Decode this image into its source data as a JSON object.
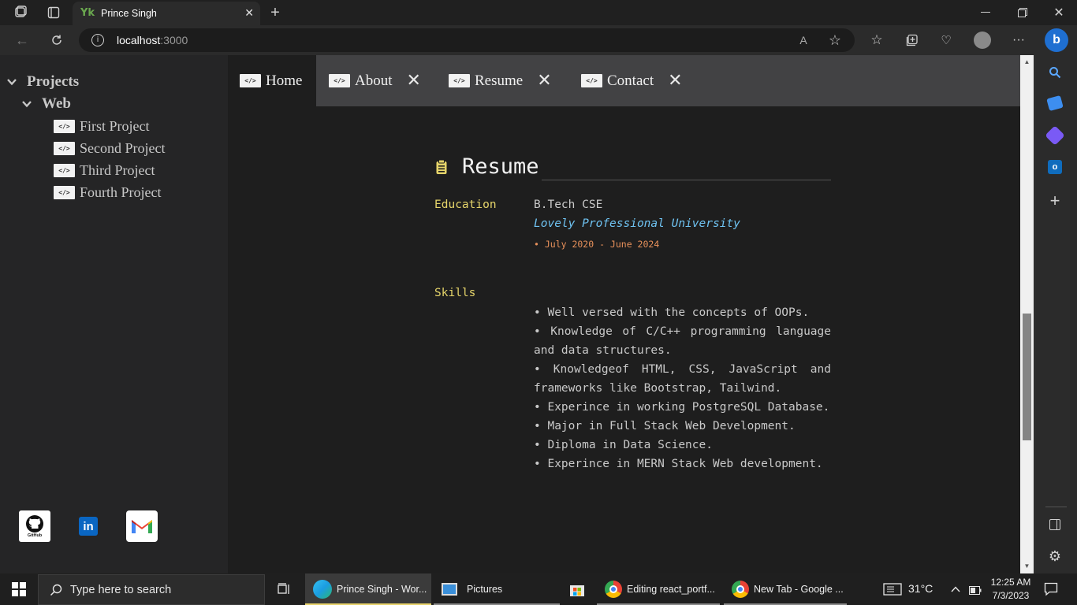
{
  "browser": {
    "tab_title": "Prince Singh",
    "url_host": "localhost",
    "url_port": ":3000"
  },
  "explorer": {
    "root_label": "Projects",
    "folder_label": "Web",
    "code_badge": "</>",
    "projects": [
      "First Project",
      "Second Project",
      "Third Project",
      "Fourth Project"
    ]
  },
  "social": {
    "github_caption": "GitHub",
    "linkedin_text": "in"
  },
  "editor_tabs": {
    "home": "Home",
    "about": "About",
    "resume": "Resume",
    "contact": "Contact"
  },
  "resume": {
    "heading": "Resume",
    "education_label": "Education",
    "degree": "B.Tech CSE",
    "school": "Lovely Professional University",
    "dates": "• July 2020 - June 2024",
    "skills_label": "Skills",
    "skills": [
      "• Well versed with the concepts of OOPs.",
      "• Knowledge of C/C++ programming language and data structures.",
      "• Knowledgeof HTML, CSS, JavaScript and frameworks like Bootstrap, Tailwind.",
      "• Experince in working PostgreSQL Database.",
      "• Major in Full Stack Web Development.",
      "• Diploma in Data Science.",
      "• Experince in MERN Stack Web development."
    ]
  },
  "taskbar": {
    "search_placeholder": "Type here to search",
    "apps": [
      "Prince Singh - Wor...",
      "Pictures",
      "Editing react_portf...",
      "New Tab - Google ..."
    ],
    "weather": "31°C",
    "time": "12:25 AM",
    "date": "7/3/2023"
  },
  "colors": {
    "section_label": "#e5d46a",
    "school": "#6fc3f2",
    "dates": "#e8915b",
    "tabstrip": "#424244",
    "explorer_bg": "#252526",
    "editor_bg": "#1e1e1e"
  }
}
